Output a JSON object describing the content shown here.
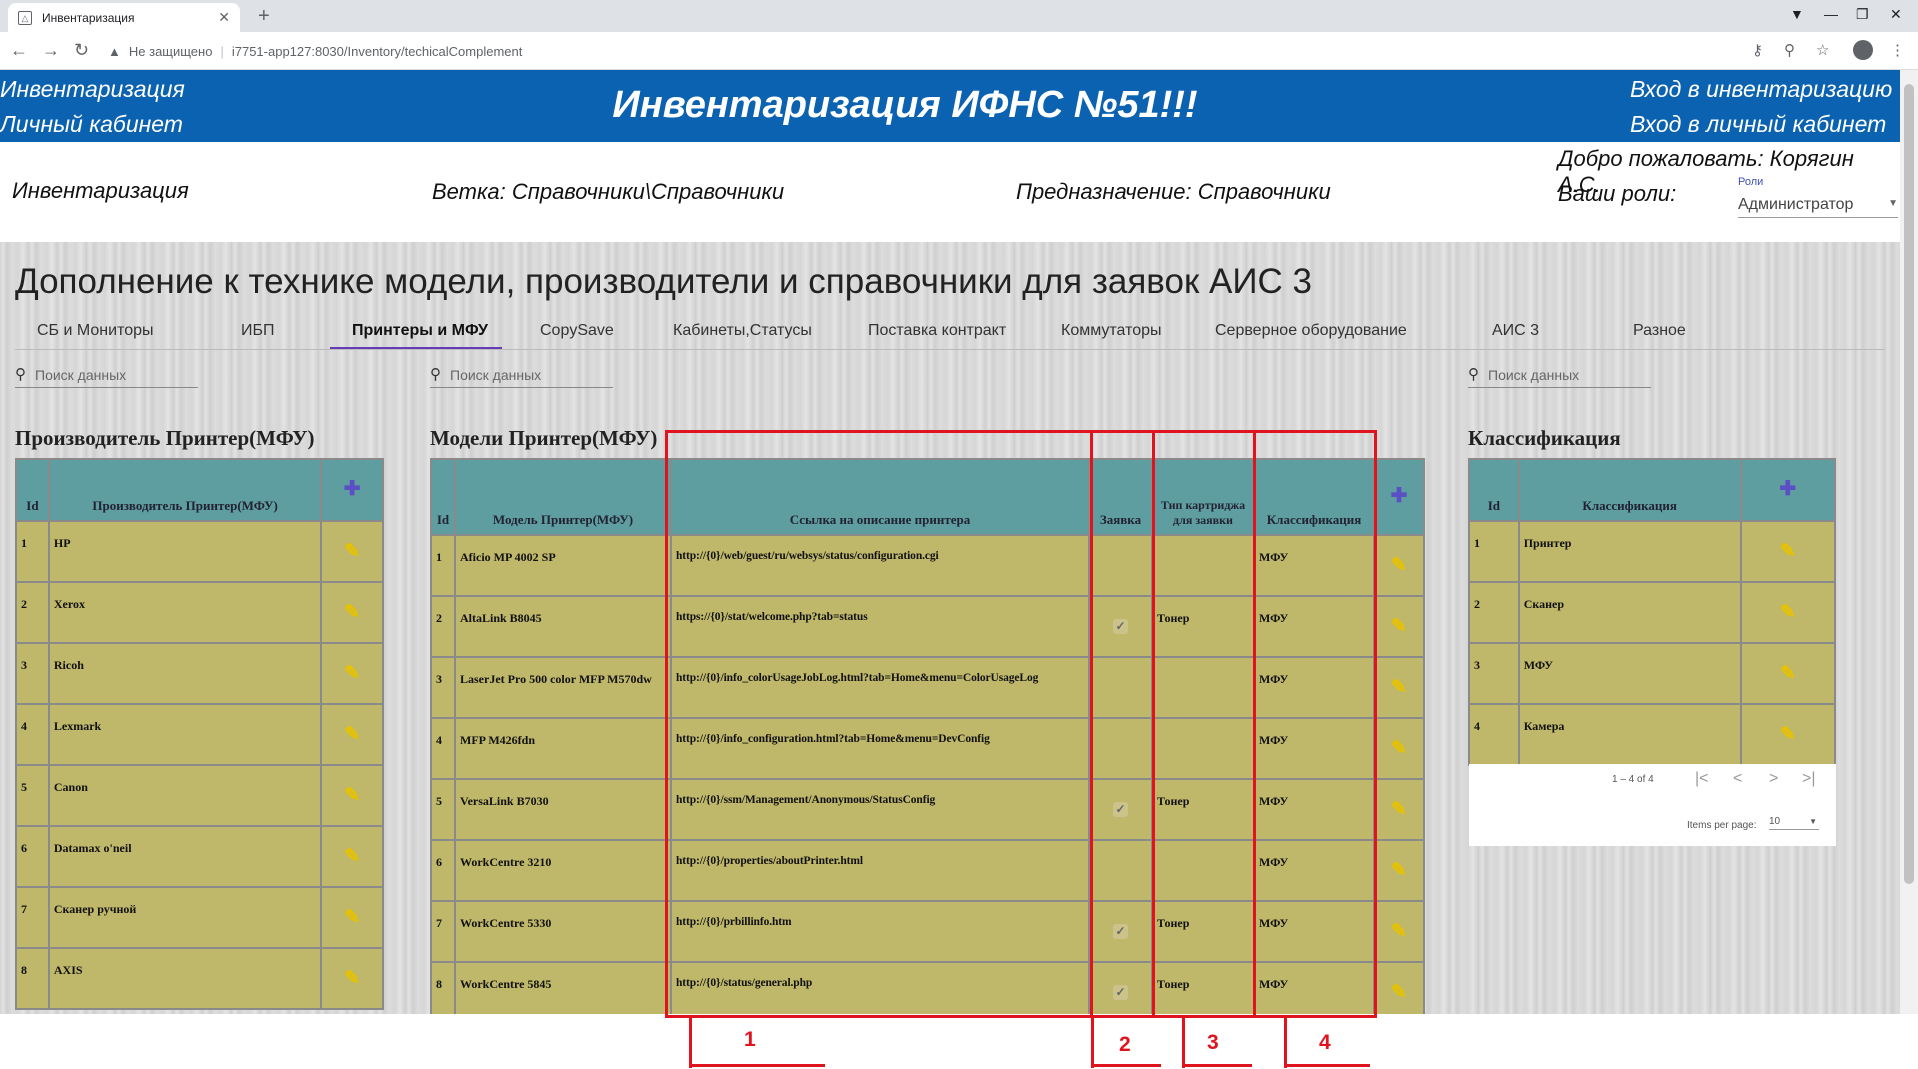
{
  "browser": {
    "tab_title": "Инвентаризация",
    "tab_favicon": "app-icon",
    "not_secure": "Не защищено",
    "url": "i7751-app127:8030/Inventory/techicalComplement"
  },
  "header": {
    "left_top": "Инвентаризация",
    "left_bottom": "Личный кабинет",
    "title": "Инвентаризация ИФНС №51!!!",
    "right_top": "Вход в инвентаризацию",
    "right_bottom": "Вход в личный кабинет",
    "background_color": "#0b62b0"
  },
  "info": {
    "section": "Инвентаризация",
    "branch": "Ветка: Справочники\\Справочники",
    "purpose": "Предназначение: Справочники",
    "welcome": "Добро пожаловать: Корягин А.С.",
    "roles_label": "Ваши роли:",
    "roles_field_label": "Роли",
    "roles_value": "Администратор"
  },
  "page_title": "Дополнение к технике модели, производители и справочники для заявок АИС 3",
  "tabs": [
    "СБ и Мониторы",
    "ИБП",
    "Принтеры и МФУ",
    "CopySave",
    "Кабинеты,Статусы",
    "Поставка контракт",
    "Коммутаторы",
    "Серверное оборудование",
    "АИС 3",
    "Разное"
  ],
  "active_tab": "Принтеры и МФУ",
  "search_placeholder": "Поиск данных",
  "manufacturers": {
    "title": "Производитель Принтер(МФУ)",
    "headers": [
      "Id",
      "Производитель Принтер(МФУ)"
    ],
    "rows": [
      [
        "1",
        "HP"
      ],
      [
        "2",
        "Xerox"
      ],
      [
        "3",
        "Ricoh"
      ],
      [
        "4",
        "Lexmark"
      ],
      [
        "5",
        "Canon"
      ],
      [
        "6",
        "Datamax o'neil"
      ],
      [
        "7",
        "Сканер ручной"
      ],
      [
        "8",
        "AXIS"
      ]
    ]
  },
  "models": {
    "title": "Модели Принтер(МФУ)",
    "headers": [
      "Id",
      "Модель Принтер(МФУ)",
      "Ссылка на описание принтера",
      "Заявка",
      "Тип картриджа для заявки",
      "Классификация"
    ],
    "rows": [
      {
        "id": "1",
        "model": "Aficio MP 4002 SP",
        "link": "http://{0}/web/guest/ru/websys/status/configuration.cgi",
        "request": false,
        "cartridge": "",
        "class": "МФУ"
      },
      {
        "id": "2",
        "model": "AltaLink B8045",
        "link": "https://{0}/stat/welcome.php?tab=status",
        "request": true,
        "cartridge": "Тонер",
        "class": "МФУ"
      },
      {
        "id": "3",
        "model": "LaserJet Pro 500 color MFP M570dw",
        "link": "http://{0}/info_colorUsageJobLog.html?tab=Home&menu=ColorUsageLog",
        "request": false,
        "cartridge": "",
        "class": "МФУ"
      },
      {
        "id": "4",
        "model": "MFP M426fdn",
        "link": "http://{0}/info_configuration.html?tab=Home&menu=DevConfig",
        "request": false,
        "cartridge": "",
        "class": "МФУ"
      },
      {
        "id": "5",
        "model": "VersaLink B7030",
        "link": "http://{0}/ssm/Management/Anonymous/StatusConfig",
        "request": true,
        "cartridge": "Тонер",
        "class": "МФУ"
      },
      {
        "id": "6",
        "model": "WorkCentre 3210",
        "link": "http://{0}/properties/aboutPrinter.html",
        "request": false,
        "cartridge": "",
        "class": "МФУ"
      },
      {
        "id": "7",
        "model": "WorkCentre 5330",
        "link": "http://{0}/prbillinfo.htm",
        "request": true,
        "cartridge": "Тонер",
        "class": "МФУ"
      },
      {
        "id": "8",
        "model": "WorkCentre 5845",
        "link": "http://{0}/status/general.php",
        "request": true,
        "cartridge": "Тонер",
        "class": "МФУ"
      }
    ]
  },
  "classification": {
    "title": "Классификация",
    "headers": [
      "Id",
      "Классификация"
    ],
    "rows": [
      [
        "1",
        "Принтер"
      ],
      [
        "2",
        "Сканер"
      ],
      [
        "3",
        "МФУ"
      ],
      [
        "4",
        "Камера"
      ]
    ],
    "range": "1 – 4 of 4",
    "items_per_page_label": "Items per page:",
    "items_per_page": "10"
  },
  "annotations": [
    "1",
    "2",
    "3",
    "4"
  ],
  "colors": {
    "table_header": "#5f9ea0",
    "table_cell": "#bfb76a",
    "edit_icon": "#e6c200",
    "annotation": "#e0141e",
    "active_tab_ink": "#673ab7"
  }
}
